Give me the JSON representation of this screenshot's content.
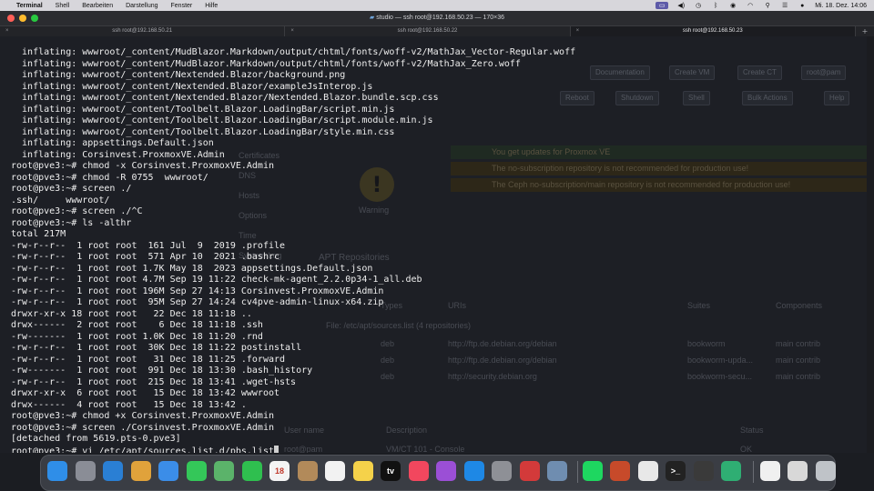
{
  "menubar": {
    "apple": "",
    "items": [
      "Terminal",
      "Shell",
      "Bearbeiten",
      "Darstellung",
      "Fenster",
      "Hilfe"
    ],
    "clock": "Mi. 18. Dez.  14:06"
  },
  "window": {
    "title": "studio — ssh root@192.168.50.23 — 170×36",
    "tabs": [
      {
        "label": "ssh root@192.168.50.21",
        "active": false
      },
      {
        "label": "ssh root@192.168.50.22",
        "active": false
      },
      {
        "label": "ssh root@192.168.50.23",
        "active": true
      }
    ],
    "tab_close": "×",
    "add_tab": "+"
  },
  "terminal": {
    "lines": [
      "  inflating: wwwroot/_content/MudBlazor.Markdown/output/chtml/fonts/woff-v2/MathJax_Vector-Regular.woff",
      "  inflating: wwwroot/_content/MudBlazor.Markdown/output/chtml/fonts/woff-v2/MathJax_Zero.woff",
      "  inflating: wwwroot/_content/Nextended.Blazor/background.png",
      "  inflating: wwwroot/_content/Nextended.Blazor/exampleJsInterop.js",
      "  inflating: wwwroot/_content/Nextended.Blazor/Nextended.Blazor.bundle.scp.css",
      "  inflating: wwwroot/_content/Toolbelt.Blazor.LoadingBar/script.min.js",
      "  inflating: wwwroot/_content/Toolbelt.Blazor.LoadingBar/script.module.min.js",
      "  inflating: wwwroot/_content/Toolbelt.Blazor.LoadingBar/style.min.css",
      "  inflating: appsettings.Default.json",
      "  inflating: Corsinvest.ProxmoxVE.Admin",
      "root@pve3:~# chmod -x Corsinvest.ProxmoxVE.Admin",
      "root@pve3:~# chmod -R 0755  wwwroot/",
      "root@pve3:~# screen ./",
      ".ssh/     wwwroot/",
      "root@pve3:~# screen ./^C",
      "root@pve3:~# ls -althr",
      "total 217M",
      "-rw-r--r--  1 root root  161 Jul  9  2019 .profile",
      "-rw-r--r--  1 root root  571 Apr 10  2021 .bashrc",
      "-rw-r--r--  1 root root 1.7K May 18  2023 appsettings.Default.json",
      "-rw-r--r--  1 root root 4.7M Sep 19 11:22 check-mk-agent_2.2.0p34-1_all.deb",
      "-rw-r--r--  1 root root 196M Sep 27 14:13 Corsinvest.ProxmoxVE.Admin",
      "-rw-r--r--  1 root root  95M Sep 27 14:24 cv4pve-admin-linux-x64.zip",
      "drwxr-xr-x 18 root root   22 Dec 18 11:18 ..",
      "drwx------  2 root root    6 Dec 18 11:18 .ssh",
      "-rw-------  1 root root 1.0K Dec 18 11:20 .rnd",
      "-rw-r--r--  1 root root  30K Dec 18 11:22 postinstall",
      "-rw-r--r--  1 root root   31 Dec 18 11:25 .forward",
      "-rw-------  1 root root  991 Dec 18 13:30 .bash_history",
      "-rw-r--r--  1 root root  215 Dec 18 13:41 .wget-hsts",
      "drwxr-xr-x  6 root root   15 Dec 18 13:42 wwwroot",
      "drwx------  4 root root   15 Dec 18 13:42 .",
      "root@pve3:~# chmod +x Corsinvest.ProxmoxVE.Admin",
      "root@pve3:~# screen ./Corsinvest.ProxmoxVE.Admin",
      "[detached from 5619.pts-0.pve3]"
    ],
    "prompt": "root@pve3:~# ",
    "current_command": "vi /etc/apt/sources.list.d/pbs.list"
  },
  "background_ui": {
    "buttons": [
      "Documentation",
      "Create VM",
      "Create CT",
      "root@pam",
      "Reboot",
      "Shutdown",
      "Shell",
      "Bulk Actions",
      "Help"
    ],
    "nav": [
      "Certificates",
      "DNS",
      "Hosts",
      "Options",
      "Time",
      "System Log"
    ],
    "warning_label": "Warning",
    "messages": [
      "You get updates for Proxmox VE",
      "The no-subscription repository is not recommended for production use!",
      "The Ceph no-subscription/main repository is not recommended for production use!"
    ],
    "apt_title": "APT Repositories",
    "columns": [
      "Types",
      "URIs",
      "Suites",
      "Components"
    ],
    "file_label": "File: /etc/apt/sources.list (4 repositories)",
    "rows": [
      {
        "type": "deb",
        "uri": "http://ftp.de.debian.org/debian",
        "suite": "bookworm",
        "comp": "main contrib"
      },
      {
        "type": "deb",
        "uri": "http://ftp.de.debian.org/debian",
        "suite": "bookworm-upda...",
        "comp": "main contrib"
      },
      {
        "type": "deb",
        "uri": "http://security.debian.org",
        "suite": "bookworm-secu...",
        "comp": "main contrib"
      }
    ],
    "bottom_columns": [
      "User name",
      "Description",
      "Status"
    ],
    "bottom_row": {
      "user": "root@pam",
      "desc": "VM/CT 101 - Console",
      "status": "OK"
    }
  },
  "dock": {
    "apps": [
      {
        "name": "finder-icon",
        "glyph": "",
        "color": "#2f8ee8"
      },
      {
        "name": "launchpad-icon",
        "glyph": "",
        "color": "#8a8d96"
      },
      {
        "name": "safari-icon",
        "glyph": "",
        "color": "#2a7fd4"
      },
      {
        "name": "photos-icon",
        "glyph": "",
        "color": "#e0a23b"
      },
      {
        "name": "mail-icon",
        "glyph": "",
        "color": "#3b8de8"
      },
      {
        "name": "messages-icon",
        "glyph": "",
        "color": "#34c759"
      },
      {
        "name": "maps-icon",
        "glyph": "",
        "color": "#5bb36a"
      },
      {
        "name": "facetime-icon",
        "glyph": "",
        "color": "#2fbf4f"
      },
      {
        "name": "calendar-icon",
        "glyph": "18",
        "color": "#f4f4f4"
      },
      {
        "name": "contacts-icon",
        "glyph": "",
        "color": "#b28a5a"
      },
      {
        "name": "reminders-icon",
        "glyph": "",
        "color": "#f2f2f2"
      },
      {
        "name": "notes-icon",
        "glyph": "",
        "color": "#f5d24a"
      },
      {
        "name": "tv-icon",
        "glyph": "tv",
        "color": "#111111"
      },
      {
        "name": "music-icon",
        "glyph": "",
        "color": "#f2475e"
      },
      {
        "name": "podcasts-icon",
        "glyph": "",
        "color": "#9b4fd6"
      },
      {
        "name": "app-store-icon",
        "glyph": "",
        "color": "#1e88e5"
      },
      {
        "name": "system-settings-icon",
        "glyph": "",
        "color": "#8e9096"
      },
      {
        "name": "authy-icon",
        "glyph": "",
        "color": "#d33a3a"
      },
      {
        "name": "proxyman-icon",
        "glyph": "",
        "color": "#6f8db0"
      },
      {
        "name": "spotify-icon",
        "glyph": "",
        "color": "#1ed760"
      },
      {
        "name": "game-icon",
        "glyph": "",
        "color": "#c74a2a"
      },
      {
        "name": "chrome-icon",
        "glyph": "",
        "color": "#e8e8e8"
      },
      {
        "name": "terminal-icon",
        "glyph": ">_",
        "color": "#222222"
      },
      {
        "name": "calculator-icon",
        "glyph": "",
        "color": "#3a3a3a"
      },
      {
        "name": "sync-icon",
        "glyph": "",
        "color": "#2fae73"
      },
      {
        "name": "document-icon",
        "glyph": "",
        "color": "#f0f0f0"
      },
      {
        "name": "preview-icon",
        "glyph": "",
        "color": "#d8d8d8"
      },
      {
        "name": "trash-icon",
        "glyph": "",
        "color": "#bfc3c8"
      }
    ]
  }
}
